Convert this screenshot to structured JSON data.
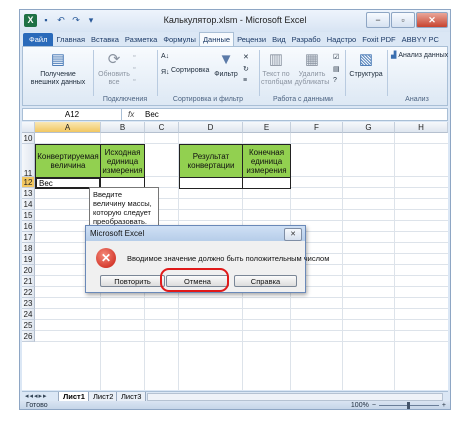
{
  "window": {
    "title": "Калькулятор.xlsm  -  Microsoft Excel",
    "app_icon": "X",
    "controls": {
      "minimize": "−",
      "maximize": "▫",
      "close": "✕"
    }
  },
  "ribbon_tabs": [
    "Файл",
    "Главная",
    "Вставка",
    "Разметка",
    "Формулы",
    "Данные",
    "Рецензи",
    "Вид",
    "Разрабо",
    "Надстро",
    "Foxit PDF",
    "ABBYY PC"
  ],
  "ribbon": {
    "external_data": "Получение внешних данных",
    "refresh_all": "Обновить все",
    "connections_group": "Подключения",
    "sort": "Сортировка",
    "filter": "Фильтр",
    "sort_filter_group": "Сортировка и фильтр",
    "text_to_columns": "Текст по столбцам",
    "remove_duplicates": "Удалить дубликаты",
    "data_tools_group": "Работа с данными",
    "outline": "Структура",
    "data_analysis": "Анализ данных",
    "analysis_group": "Анализ"
  },
  "formula_bar": {
    "name_box": "A12",
    "fx": "fx",
    "formula": "Вес"
  },
  "columns": [
    "A",
    "B",
    "C",
    "D",
    "E",
    "F",
    "G",
    "H"
  ],
  "rows": [
    "10",
    "11",
    "12",
    "13",
    "14",
    "15",
    "16",
    "17",
    "18",
    "19",
    "20",
    "21",
    "22",
    "23",
    "24",
    "25",
    "26"
  ],
  "cells": {
    "a11": "Конвертируемая величина",
    "b11": "Исходная единица измерения",
    "d11": "Результат конвертации",
    "e11": "Конечная единица измерения",
    "a12": "Вес"
  },
  "validation_tooltip": "Введите величину массы, которую следует преобразовать.",
  "dialog": {
    "title": "Microsoft Excel",
    "close": "✕",
    "message": "Вводимое значение должно быть положительным числом",
    "buttons": {
      "retry": "Повторить",
      "cancel": "Отмена",
      "help": "Справка"
    }
  },
  "sheets": [
    "Лист1",
    "Лист2",
    "Лист3"
  ],
  "status": {
    "ready": "Готово",
    "zoom": "100%"
  },
  "colors": {
    "header_green": "#92d050",
    "highlight": "#e01a1a",
    "file_tab": "#2a6aba"
  }
}
